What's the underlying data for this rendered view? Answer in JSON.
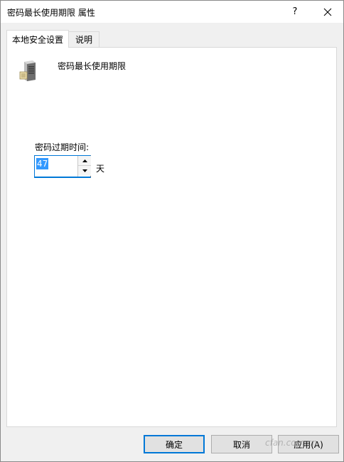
{
  "window": {
    "title": "密码最长使用期限 属性",
    "help_glyph": "?",
    "close_icon": "close-icon"
  },
  "tabs": [
    {
      "label": "本地安全设置",
      "active": true
    },
    {
      "label": "说明",
      "active": false
    }
  ],
  "policy": {
    "icon": "server-icon",
    "name": "密码最长使用期限"
  },
  "expiration": {
    "label": "密码过期时间:",
    "value": "47",
    "unit": "天"
  },
  "buttons": {
    "ok": "确定",
    "cancel": "取消",
    "apply": "应用(A)"
  },
  "watermark": "cfan.com.cn",
  "colors": {
    "accent": "#0078d7",
    "selection": "#3399ff"
  }
}
